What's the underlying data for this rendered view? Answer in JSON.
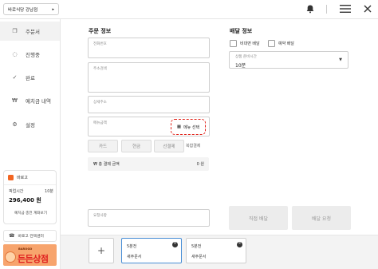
{
  "topbar": {
    "store_name": "바로식당 강남점",
    "store_chevron": "▸",
    "icons": [
      "bell-icon",
      "menu-icon",
      "close-icon"
    ]
  },
  "sidebar": {
    "items": [
      {
        "label": "주문서",
        "icon": "copy-icon",
        "glyph": "❐",
        "active": true
      },
      {
        "label": "진행중",
        "icon": "progress-circle-icon",
        "glyph": "◌",
        "active": false
      },
      {
        "label": "완료",
        "icon": "check-icon",
        "glyph": "✓",
        "active": false
      },
      {
        "label": "예치금 내역",
        "icon": "won-icon",
        "glyph": "₩",
        "active": false
      },
      {
        "label": "설정",
        "icon": "gear-icon",
        "glyph": "⚙",
        "active": false
      }
    ],
    "card": {
      "brand": "바로고",
      "hours_label": "픽업시간",
      "hours_value": "10분",
      "amount": "296,400 원",
      "refund_label": "예치금 충전 계좌보기"
    },
    "support_label": "바로고 컨택센터",
    "support_glyph": "☎",
    "banner": {
      "small_text": "BAROGO",
      "big_text": "든든상점"
    }
  },
  "order": {
    "title": "주문 정보",
    "phone_placeholder": "전화번호",
    "address_placeholder": "주소검색",
    "detail_placeholder": "상세주소",
    "menu_amount_placeholder": "메뉴금액",
    "menu_select_label": "메뉴 선택",
    "menu_select_glyph": "▦",
    "payment_buttons": [
      "카드",
      "현금",
      "선결제"
    ],
    "payment_link": "복합결제",
    "total_label": "₩  총 결제 금액",
    "total_value": "0 원",
    "request_placeholder": "요청사항"
  },
  "delivery": {
    "title": "배달 정보",
    "checkbox_contactless": "비대면 배달",
    "checkbox_reserve": "예약 배달",
    "prep_label": "상품 준비시간",
    "prep_value": "10분",
    "prep_chevron": "▼",
    "direct_button": "직접 배달",
    "request_button": "배달 요청"
  },
  "bottom": {
    "add_glyph": "+",
    "orders": [
      {
        "time": "5분전",
        "status": "새주문서",
        "selected": true
      },
      {
        "time": "5분전",
        "status": "새주문서",
        "selected": false
      }
    ],
    "close_glyph": "✕"
  }
}
